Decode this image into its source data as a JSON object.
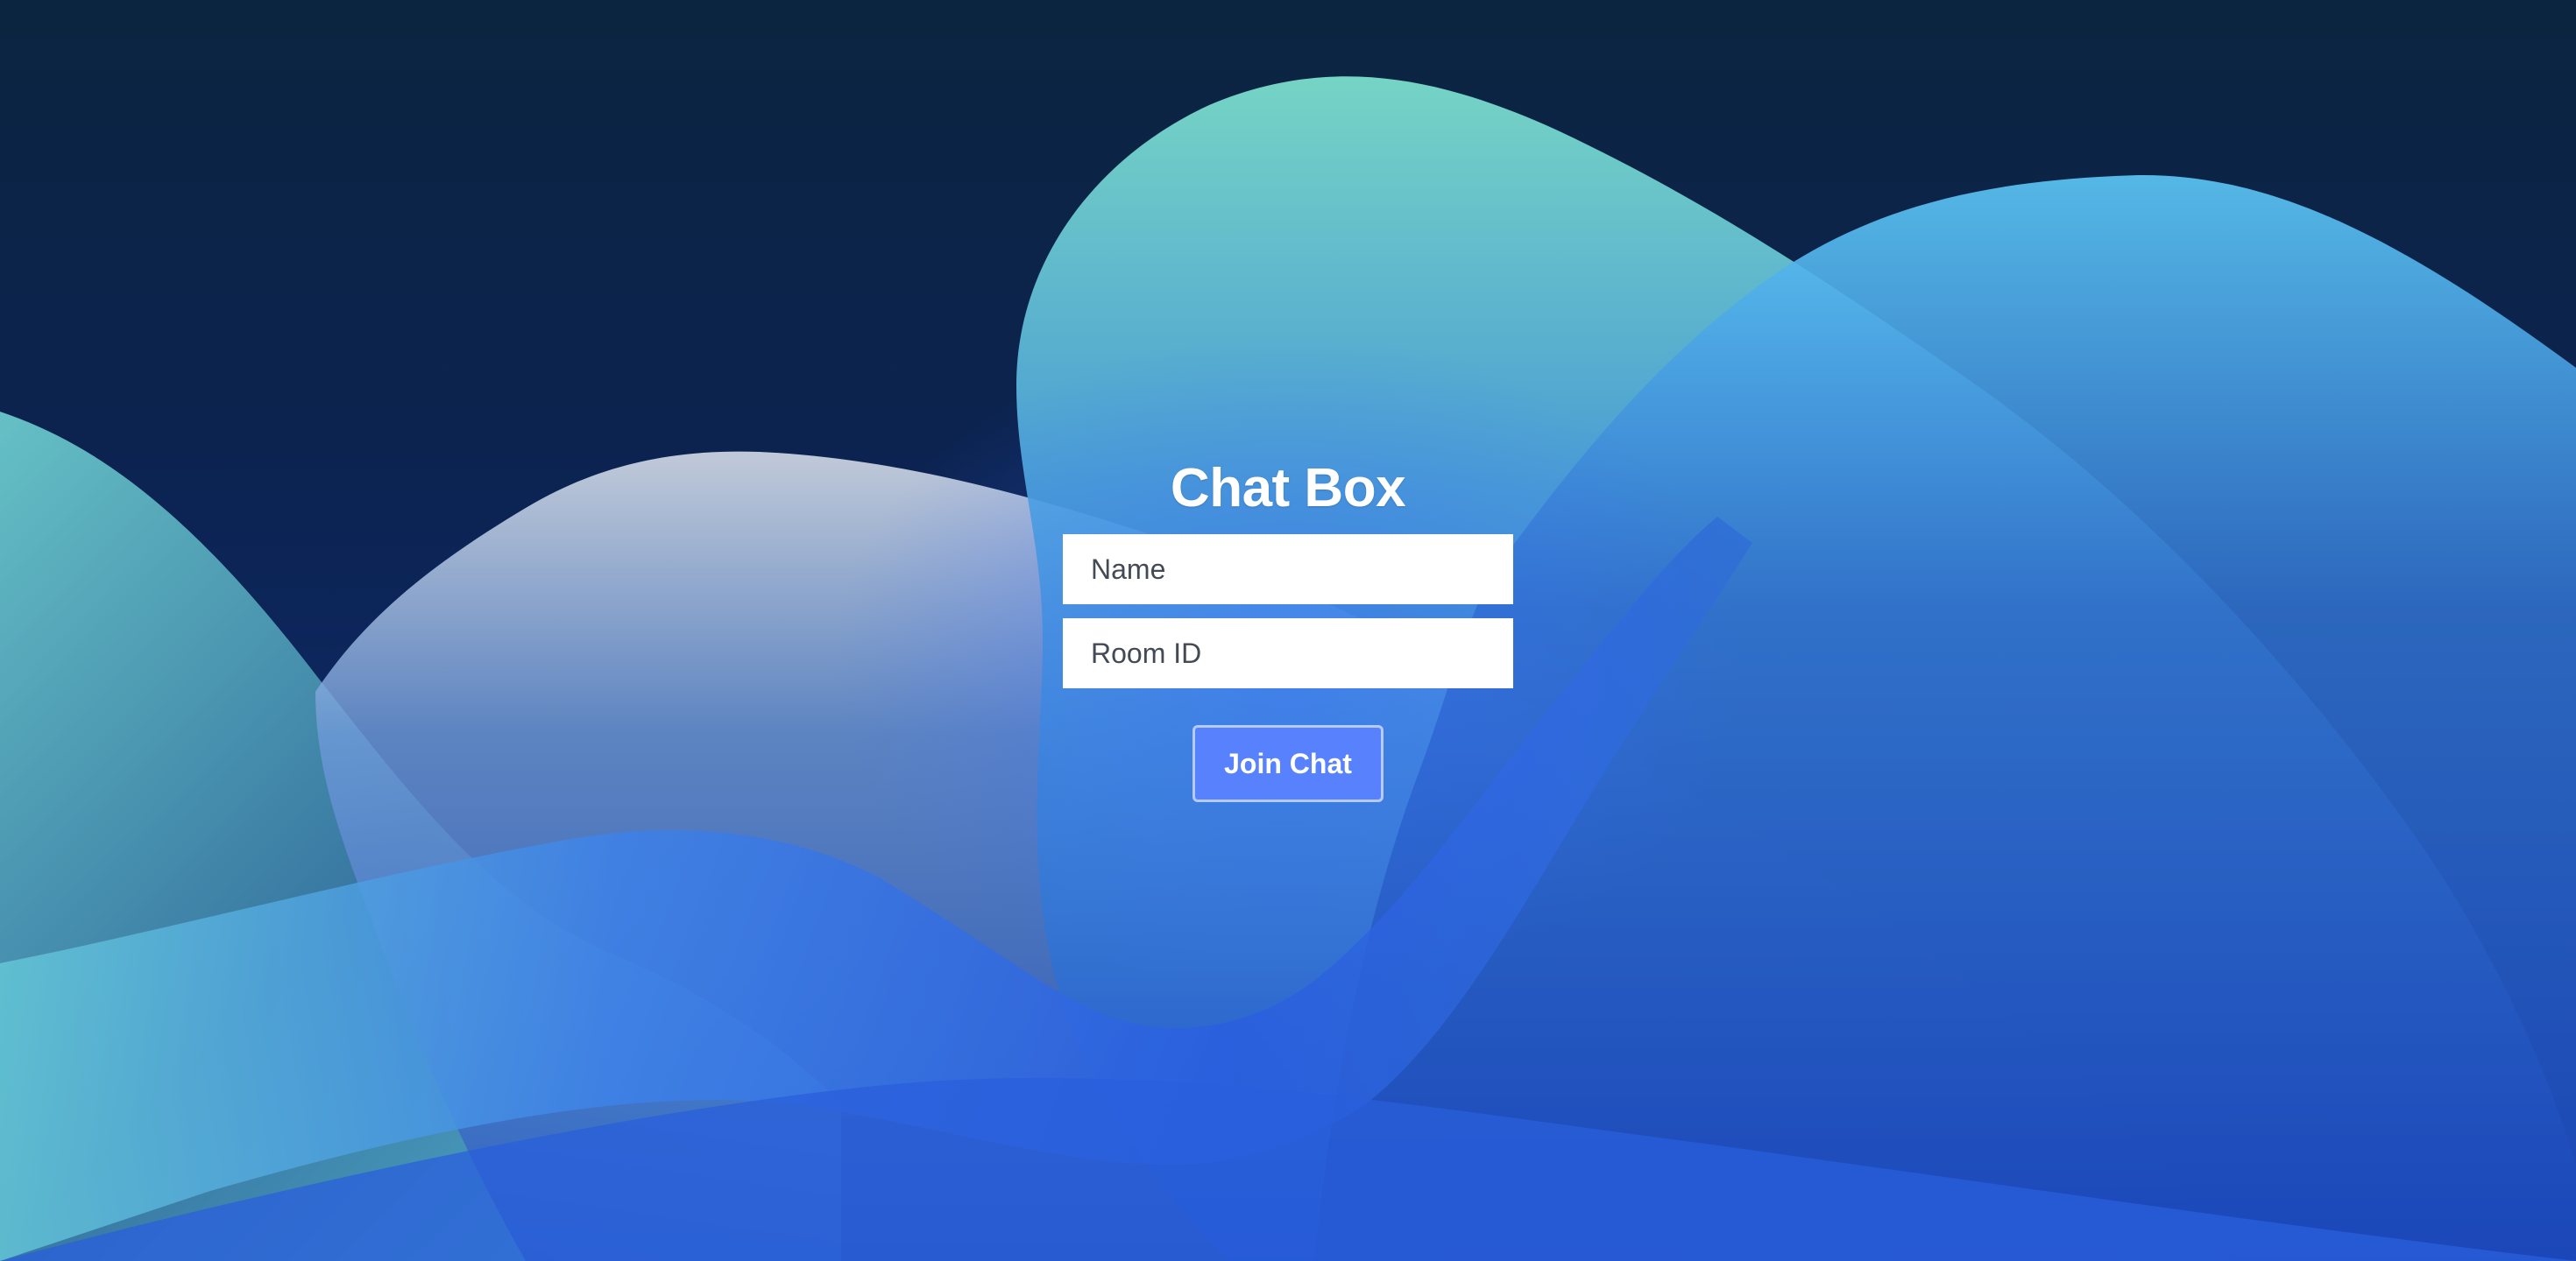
{
  "page": {
    "title": "Chat Box"
  },
  "form": {
    "name_placeholder": "Name",
    "name_value": "",
    "room_placeholder": "Room ID",
    "room_value": "",
    "join_label": "Join Chat"
  },
  "colors": {
    "background_dark": "#0b2540",
    "wave_light": "#6fd6d0",
    "wave_mid": "#3f8ee8",
    "wave_deep": "#1e4fd8",
    "button_fill": "#5a82ff",
    "button_border": "#c8d7ff",
    "input_bg": "#ffffff",
    "title_text": "#ffffff"
  }
}
